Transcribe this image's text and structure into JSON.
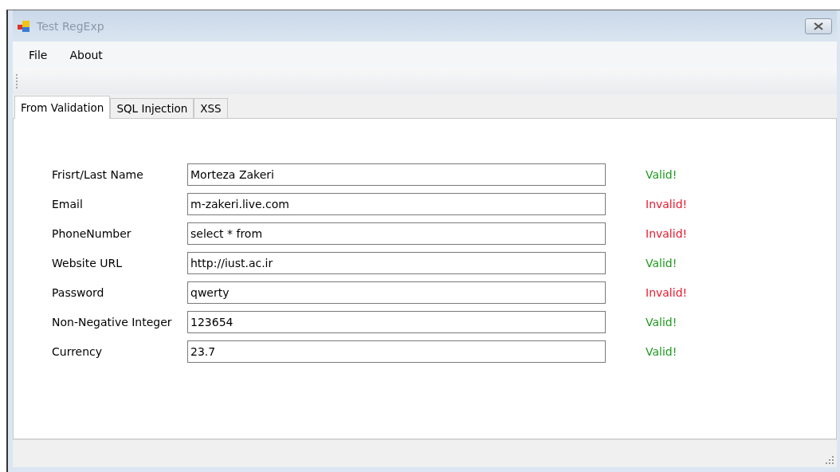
{
  "window": {
    "title": "Test RegExp"
  },
  "menu": [
    "File",
    "About"
  ],
  "tabs": [
    {
      "label": "From Validation",
      "selected": true
    },
    {
      "label": "SQL Injection",
      "selected": false
    },
    {
      "label": "XSS",
      "selected": false
    }
  ],
  "fields": [
    {
      "label": "Frisrt/Last Name",
      "value": "Morteza Zakeri",
      "status": "Valid!",
      "valid": true
    },
    {
      "label": "Email",
      "value": "m-zakeri.live.com",
      "status": "Invalid!",
      "valid": false
    },
    {
      "label": "PhoneNumber",
      "value": "select * from",
      "status": "Invalid!",
      "valid": false
    },
    {
      "label": "Website URL",
      "value": "http://iust.ac.ir",
      "status": "Valid!",
      "valid": true
    },
    {
      "label": "Password",
      "value": "qwerty",
      "status": "Invalid!",
      "valid": false
    },
    {
      "label": "Non-Negative Integer",
      "value": "123654",
      "status": "Valid!",
      "valid": true
    },
    {
      "label": "Currency",
      "value": "23.7",
      "status": "Valid!",
      "valid": true
    }
  ]
}
